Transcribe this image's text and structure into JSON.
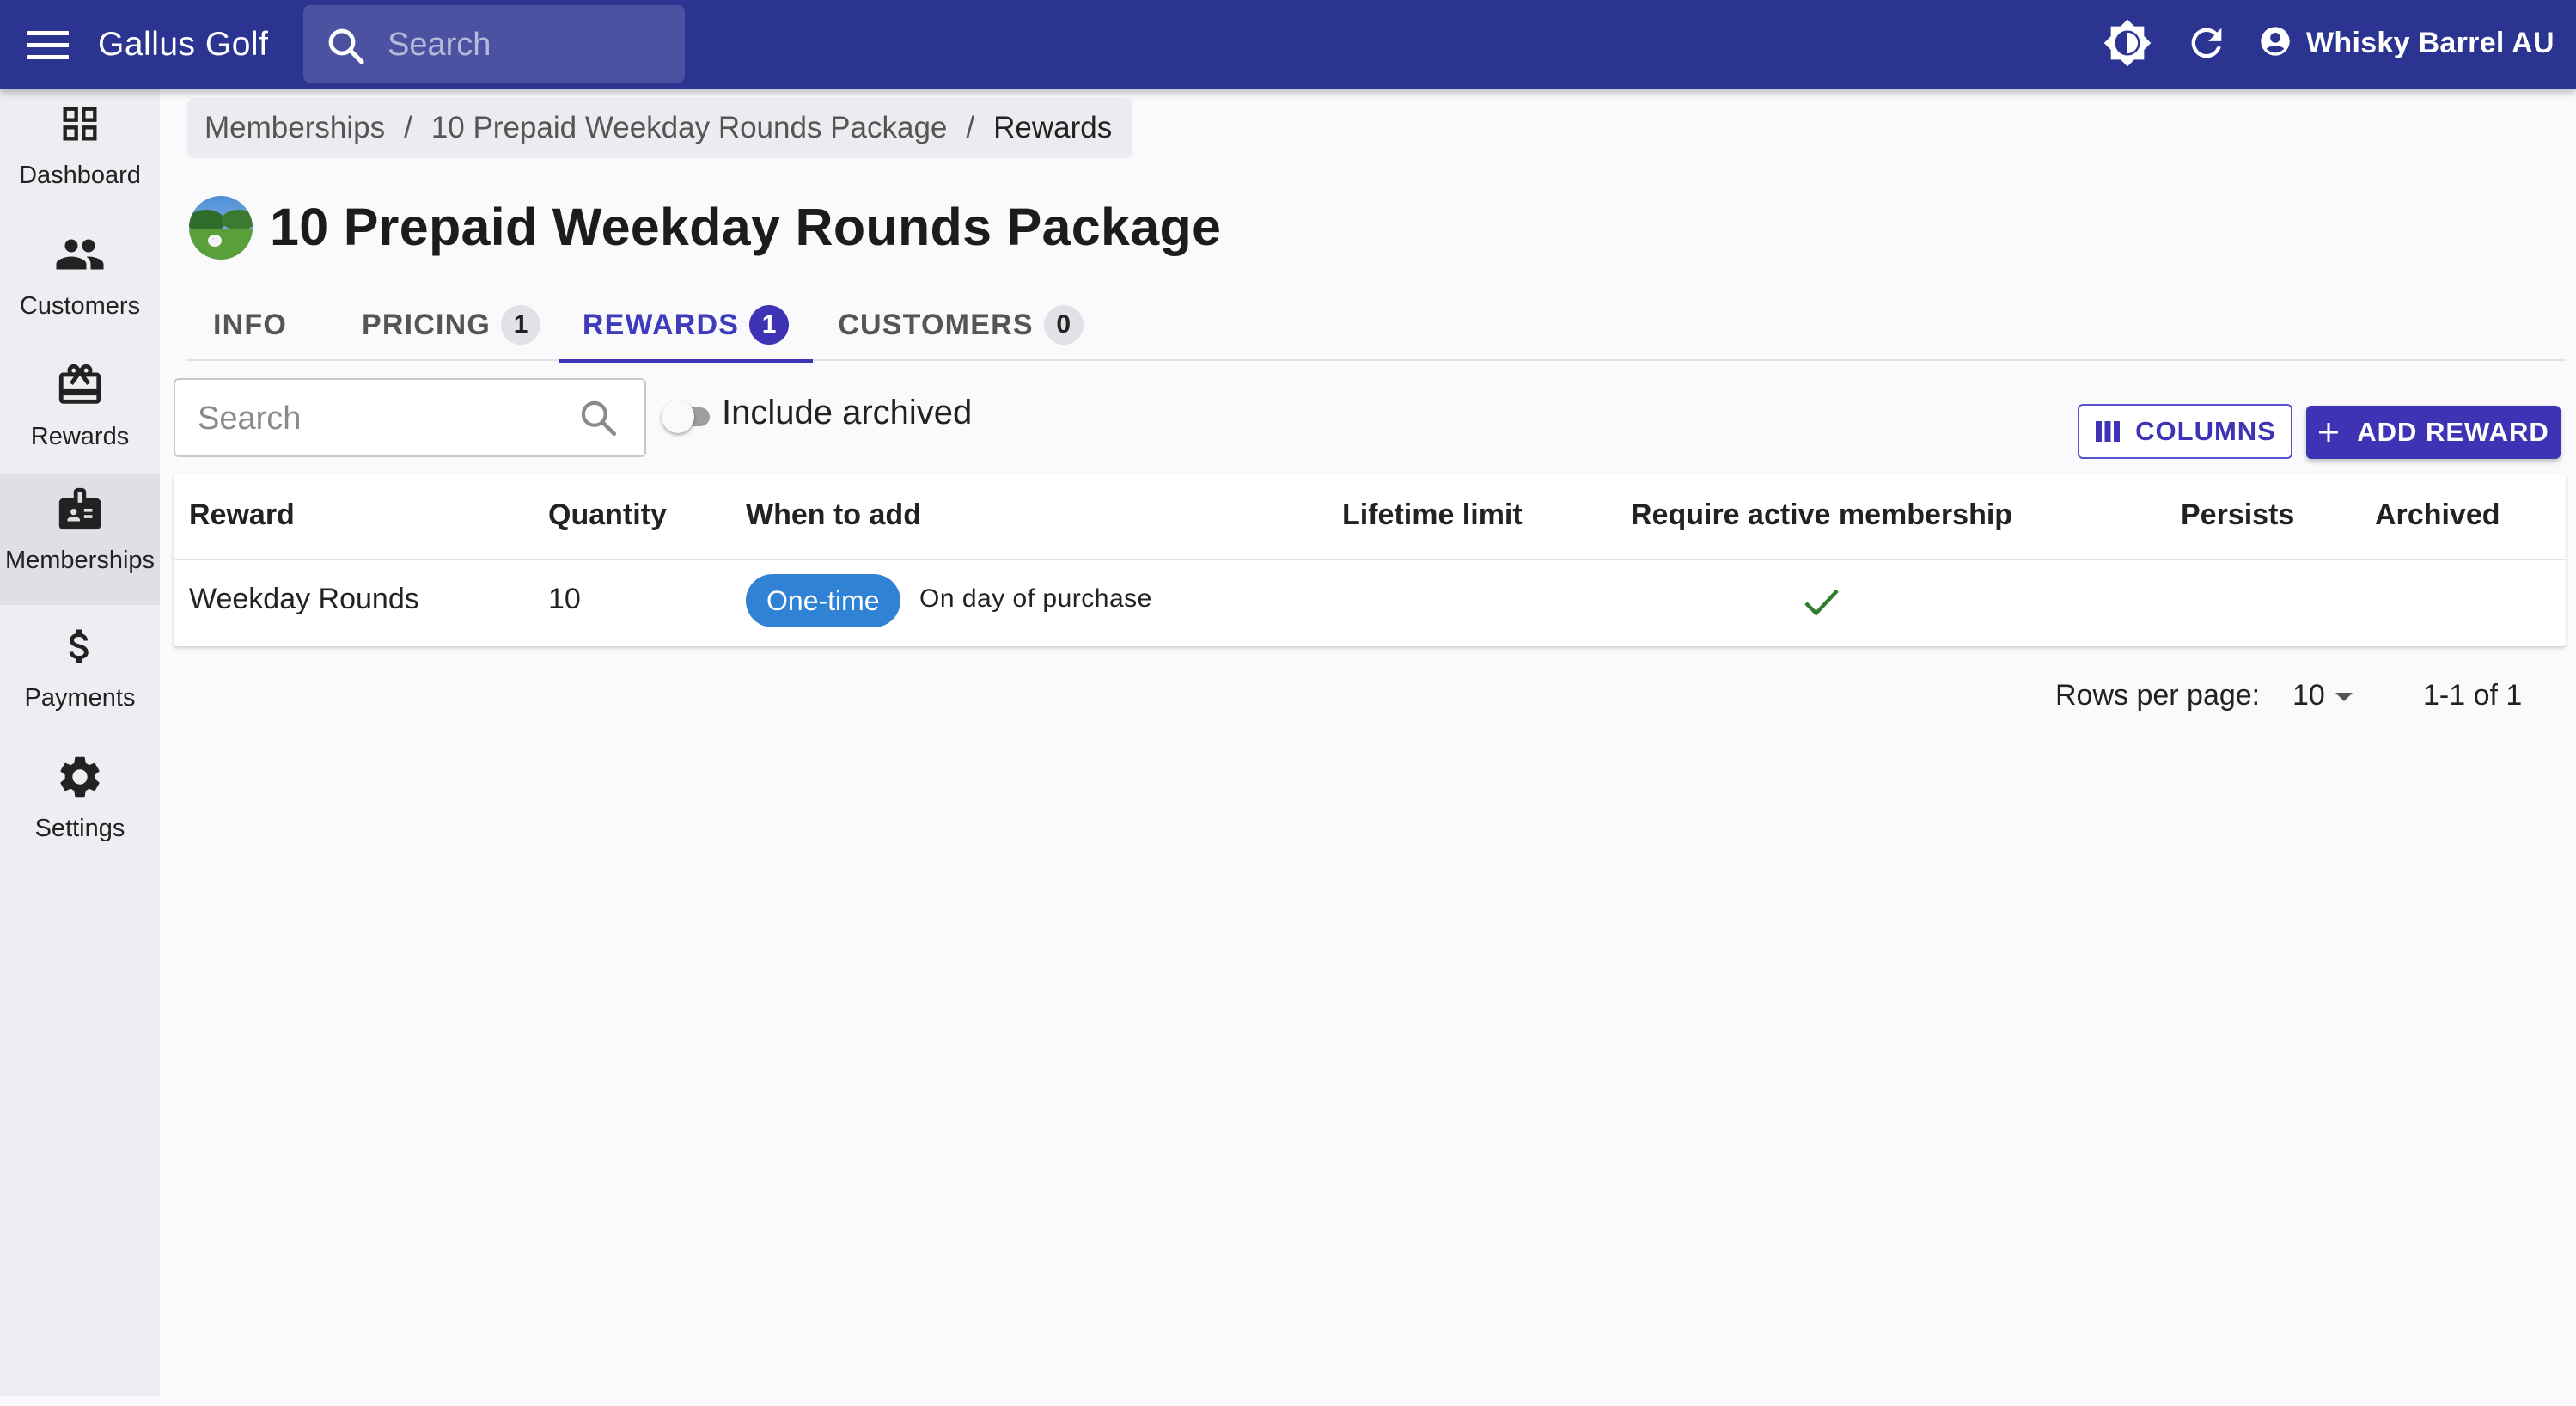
{
  "appbar": {
    "title": "Gallus Golf",
    "search_placeholder": "Search",
    "account_name": "Whisky Barrel AU",
    "icons": [
      "menu-icon",
      "search-icon",
      "theme-brightness-icon",
      "refresh-icon",
      "account-circle-icon"
    ]
  },
  "sidebar": {
    "items": [
      {
        "label": "Dashboard",
        "icon": "dashboard-icon",
        "active": false
      },
      {
        "label": "Customers",
        "icon": "people-icon",
        "active": false
      },
      {
        "label": "Rewards",
        "icon": "gift-card-icon",
        "active": false
      },
      {
        "label": "Memberships",
        "icon": "badge-icon",
        "active": true
      },
      {
        "label": "Payments",
        "icon": "dollar-icon",
        "active": false
      },
      {
        "label": "Settings",
        "icon": "gear-icon",
        "active": false
      }
    ]
  },
  "breadcrumb": {
    "items": [
      "Memberships",
      "10 Prepaid Weekday Rounds Package",
      "Rewards"
    ],
    "separator": "/"
  },
  "header": {
    "title": "10 Prepaid Weekday Rounds Package"
  },
  "tabs": [
    {
      "label": "INFO",
      "count": null,
      "active": false
    },
    {
      "label": "PRICING",
      "count": "1",
      "active": false
    },
    {
      "label": "REWARDS",
      "count": "1",
      "active": true
    },
    {
      "label": "CUSTOMERS",
      "count": "0",
      "active": false
    }
  ],
  "toolbar": {
    "search_placeholder": "Search",
    "include_archived_label": "Include archived",
    "include_archived_checked": false,
    "columns_label": "COLUMNS",
    "add_label": "ADD REWARD"
  },
  "table": {
    "columns": [
      "Reward",
      "Quantity",
      "When to add",
      "Lifetime limit",
      "Require active membership",
      "Persists",
      "Archived"
    ],
    "rows": [
      {
        "reward": "Weekday Rounds",
        "quantity": "10",
        "when_chip": "One-time",
        "when_text": "On day of purchase",
        "lifetime_limit": "",
        "require_active_membership": true,
        "persists": "",
        "archived": ""
      }
    ]
  },
  "pagination": {
    "rows_per_page_label": "Rows per page:",
    "rows_per_page": "10",
    "range": "1-1 of 1"
  },
  "colors": {
    "appbar": "#2b3491",
    "primary": "#3f33b5",
    "chip": "#2f82d4",
    "check": "#2e7d32"
  }
}
